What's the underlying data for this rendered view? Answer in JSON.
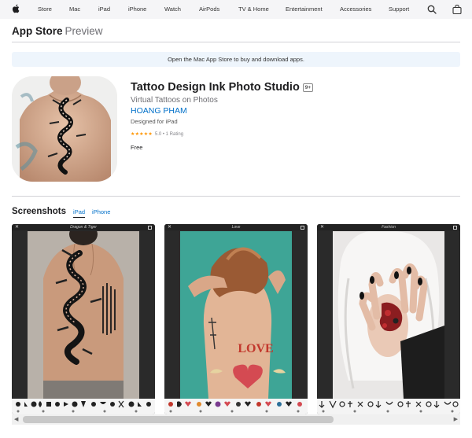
{
  "globalnav": {
    "items": [
      "Store",
      "Mac",
      "iPad",
      "iPhone",
      "Watch",
      "AirPods",
      "TV & Home",
      "Entertainment",
      "Accessories",
      "Support"
    ],
    "icons": [
      "apple-logo-icon",
      "search-icon",
      "bag-icon"
    ]
  },
  "localnav": {
    "title": "App Store",
    "subtitle": "Preview"
  },
  "banner": {
    "text": "Open the Mac App Store to buy and download apps."
  },
  "product": {
    "title": "Tattoo Design Ink Photo Studio",
    "age_rating": "9+",
    "subtitle": "Virtual Tattoos on Photos",
    "developer": "HOANG PHAM",
    "designed_for": "Designed for iPad",
    "stars": "★★★★★",
    "rating": "5.0 • 1 Rating",
    "price": "Free"
  },
  "screenshots": {
    "title": "Screenshots",
    "tabs": [
      "iPad",
      "iPhone"
    ],
    "active_tab": "iPad",
    "shots": [
      {
        "caption": "Dragon & Tiger",
        "bg": "#b8b1a9"
      },
      {
        "caption": "Love",
        "bg": "#3ea596"
      },
      {
        "caption": "Fashion",
        "bg": "#e9e7e6"
      }
    ]
  },
  "colors": {
    "link": "#0070c9",
    "nav_bg": "#f5f5f7",
    "banner_bg": "#eef5fc"
  }
}
